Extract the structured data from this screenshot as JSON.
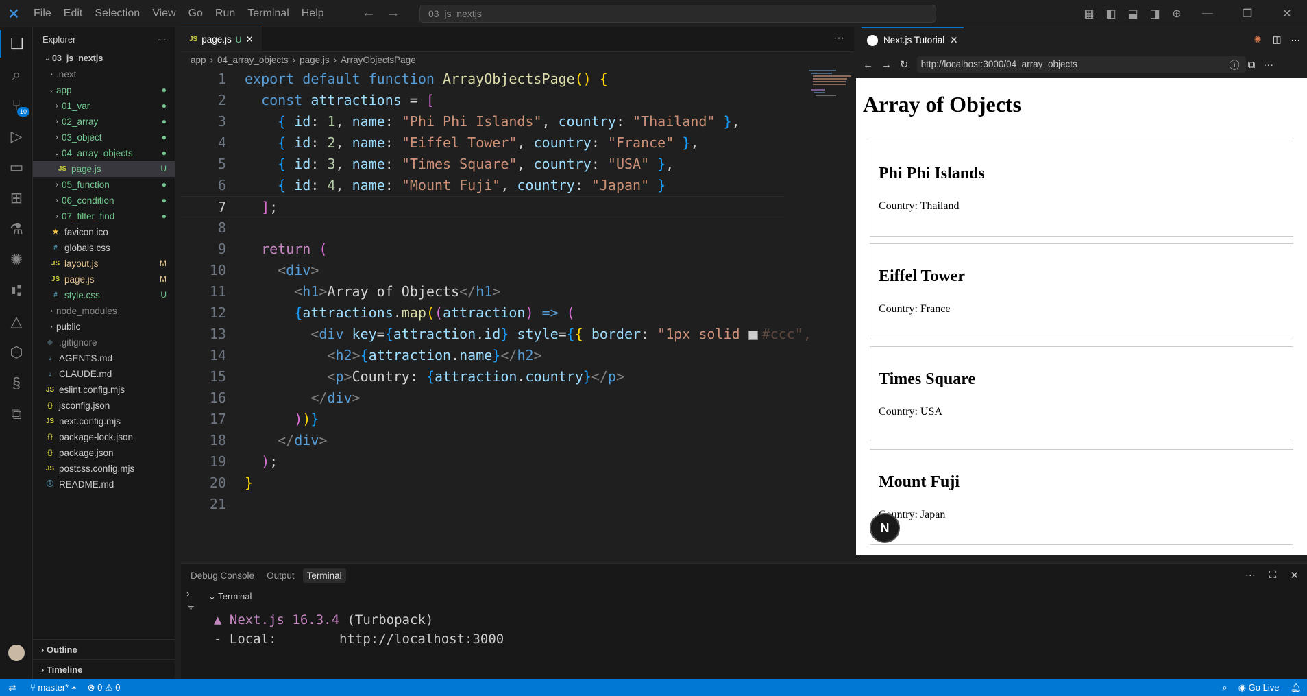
{
  "titlebar": {
    "menu": [
      "File",
      "Edit",
      "Selection",
      "View",
      "Go",
      "Run",
      "Terminal",
      "Help"
    ],
    "search_text": "03_js_nextjs"
  },
  "activity": {
    "scm_badge": "10"
  },
  "sidebar": {
    "title": "Explorer",
    "root": "03_js_nextjs",
    "items": [
      {
        "label": ".next",
        "type": "folder"
      },
      {
        "label": "app",
        "type": "folder-open"
      },
      {
        "label": "01_var",
        "type": "folder"
      },
      {
        "label": "02_array",
        "type": "folder"
      },
      {
        "label": "03_object",
        "type": "folder"
      },
      {
        "label": "04_array_objects",
        "type": "folder-open"
      },
      {
        "label": "page.js",
        "type": "file",
        "deco": "U"
      },
      {
        "label": "05_function",
        "type": "folder"
      },
      {
        "label": "06_condition",
        "type": "folder"
      },
      {
        "label": "07_filter_find",
        "type": "folder"
      },
      {
        "label": "favicon.ico",
        "type": "file"
      },
      {
        "label": "globals.css",
        "type": "file"
      },
      {
        "label": "layout.js",
        "type": "file",
        "deco": "M"
      },
      {
        "label": "page.js",
        "type": "file",
        "deco": "M"
      },
      {
        "label": "style.css",
        "type": "file",
        "deco": "U"
      },
      {
        "label": "node_modules",
        "type": "folder"
      },
      {
        "label": "public",
        "type": "folder"
      },
      {
        "label": ".gitignore",
        "type": "file"
      },
      {
        "label": "AGENTS.md",
        "type": "file"
      },
      {
        "label": "CLAUDE.md",
        "type": "file"
      },
      {
        "label": "eslint.config.mjs",
        "type": "file"
      },
      {
        "label": "jsconfig.json",
        "type": "file"
      },
      {
        "label": "next.config.mjs",
        "type": "file"
      },
      {
        "label": "package-lock.json",
        "type": "file"
      },
      {
        "label": "package.json",
        "type": "file"
      },
      {
        "label": "postcss.config.mjs",
        "type": "file"
      },
      {
        "label": "README.md",
        "type": "file"
      }
    ],
    "outline": "Outline",
    "timeline": "Timeline"
  },
  "editor": {
    "tab_label": "page.js",
    "tab_deco": "U",
    "breadcrumbs": [
      "app",
      "04_array_objects",
      "page.js",
      "ArrayObjectsPage"
    ],
    "line_numbers": [
      "1",
      "2",
      "3",
      "4",
      "5",
      "6",
      "7",
      "8",
      "9",
      "10",
      "11",
      "12",
      "13",
      "14",
      "15",
      "16",
      "17",
      "18",
      "19",
      "20",
      "21"
    ],
    "strings": {
      "comp": "ArrayObjectsPage",
      "v_attr": "attractions",
      "s1": "\"Phi Phi Islands\"",
      "c1": "\"Thailand\"",
      "s2": "\"Eiffel Tower\"",
      "c2": "\"France\"",
      "s3": "\"Times Square\"",
      "c3": "\"USA\"",
      "s4": "\"Mount Fuji\"",
      "c4": "\"Japan\"",
      "h1text": "Array of Objects",
      "border": "\"1px solid ",
      "ccc": "#ccc\","
    }
  },
  "browser": {
    "tab_label": "Next.js Tutorial",
    "url": "http://localhost:3000/04_array_objects",
    "heading": "Array of Objects",
    "cards": [
      {
        "name": "Phi Phi Islands",
        "country": "Country: Thailand"
      },
      {
        "name": "Eiffel Tower",
        "country": "Country: France"
      },
      {
        "name": "Times Square",
        "country": "Country: USA"
      },
      {
        "name": "Mount Fuji",
        "country": "Country: Japan"
      }
    ],
    "badge": "N"
  },
  "panel": {
    "tabs": [
      "Debug Console",
      "Output",
      "Terminal"
    ],
    "terminal_title": "Terminal",
    "line1_prefix": "▲ Next.js 16.3.4",
    "line1_suffix": " (Turbopack)",
    "line2": "- Local:        http://localhost:3000"
  },
  "statusbar": {
    "branch": "master*",
    "problems": "⊗ 0 ⚠ 0",
    "golive": "Go Live"
  }
}
